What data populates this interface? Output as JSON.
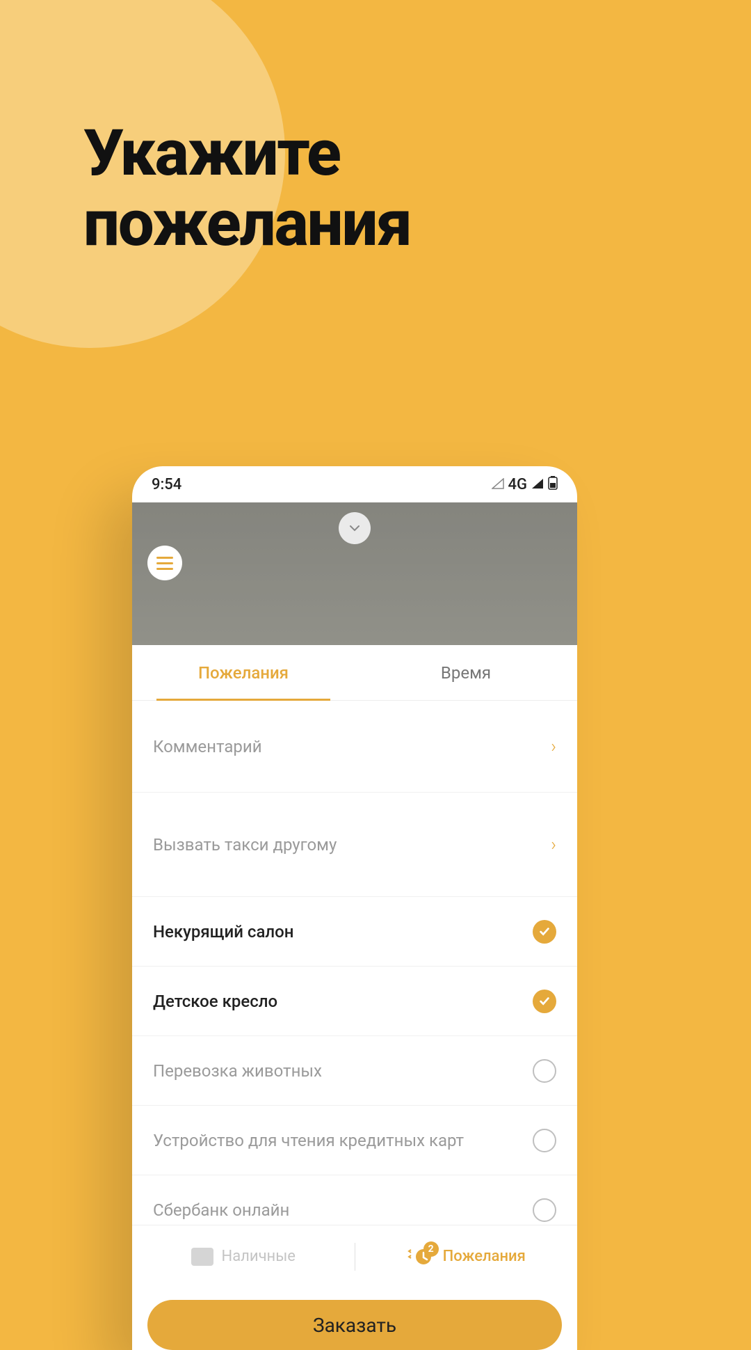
{
  "headline_line1": "Укажите",
  "headline_line2": "пожелания",
  "status": {
    "time": "9:54",
    "network": "4G"
  },
  "tabs": {
    "wishes": "Пожелания",
    "time": "Время"
  },
  "rows": {
    "comment": "Комментарий",
    "call_for_other": "Вызвать такси другому"
  },
  "options": [
    {
      "label": "Некурящий салон",
      "checked": true
    },
    {
      "label": "Детское кресло",
      "checked": true
    },
    {
      "label": "Перевозка животных",
      "checked": false
    },
    {
      "label": "Устройство для чтения кредитных карт",
      "checked": false
    },
    {
      "label": "Сбербанк онлайн",
      "checked": false
    }
  ],
  "bottom": {
    "payment": "Наличные",
    "wishes": "Пожелания",
    "badge": "2"
  },
  "order_button": "Заказать"
}
